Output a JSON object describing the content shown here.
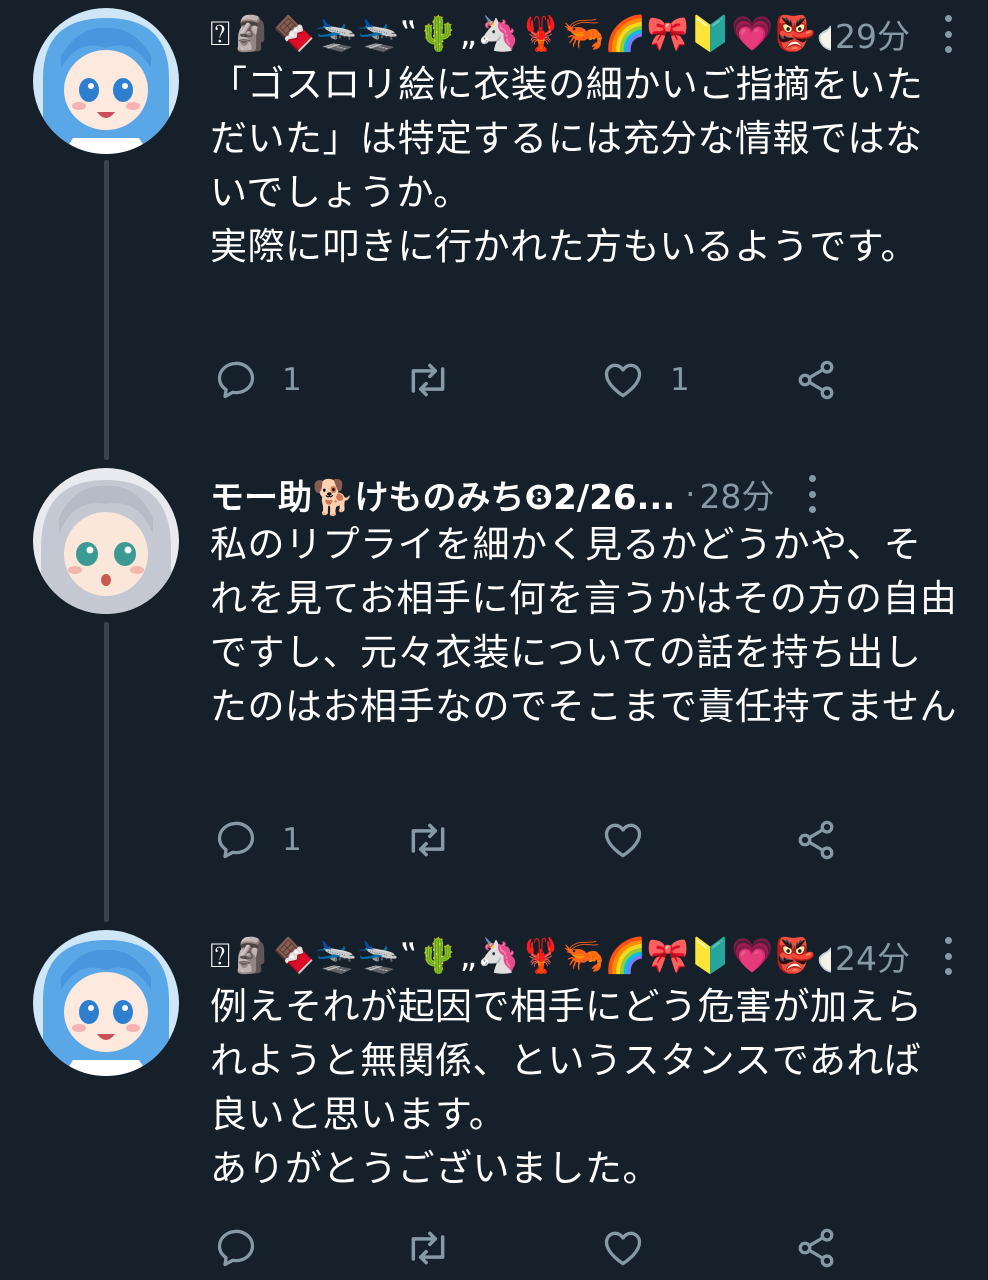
{
  "tweets": [
    {
      "display_name": "⍰🗿🍫🛬🛬‟🌵„🦄🦞🦐🌈🎀🔰💗👺🍼",
      "time": "29分",
      "text": "「ゴスロリ絵に衣装の細かいご指摘をいただいた」は特定するには充分な情報ではないでしょうか。\n実際に叩きに行かれた方もいるようです。",
      "reply_count": "1",
      "retweet_count": "",
      "like_count": "1",
      "avatar": "blue-hair-character"
    },
    {
      "display_name": "モー助🐕けものみち❽2/26...",
      "separator": "·",
      "time": "28分",
      "text": "私のリプライを細かく見るかどうかや、それを見てお相手に何を言うかはその方の自由ですし、元々衣装についての話を持ち出したのはお相手なのでそこまで責任持てません",
      "reply_count": "1",
      "retweet_count": "",
      "like_count": "",
      "avatar": "silver-hair-character"
    },
    {
      "display_name": "⍰🗿🍫🛬🛬‟🌵„🦄🦞🦐🌈🎀🔰💗👺🍼",
      "time": "24分",
      "text": "例えそれが起因で相手にどう危害が加えられようと無関係、というスタンスであれば良いと思います。\nありがとうございました。",
      "reply_count": "",
      "retweet_count": "",
      "like_count": "",
      "avatar": "blue-hair-character"
    }
  ],
  "icons": {
    "reply": "reply-icon",
    "retweet": "retweet-icon",
    "like": "heart-icon",
    "share": "share-icon",
    "more": "more-vertical-icon"
  },
  "colors": {
    "background": "#15202b",
    "text": "#ffffff",
    "secondary": "#8899a6",
    "thread_line": "#38444d"
  }
}
